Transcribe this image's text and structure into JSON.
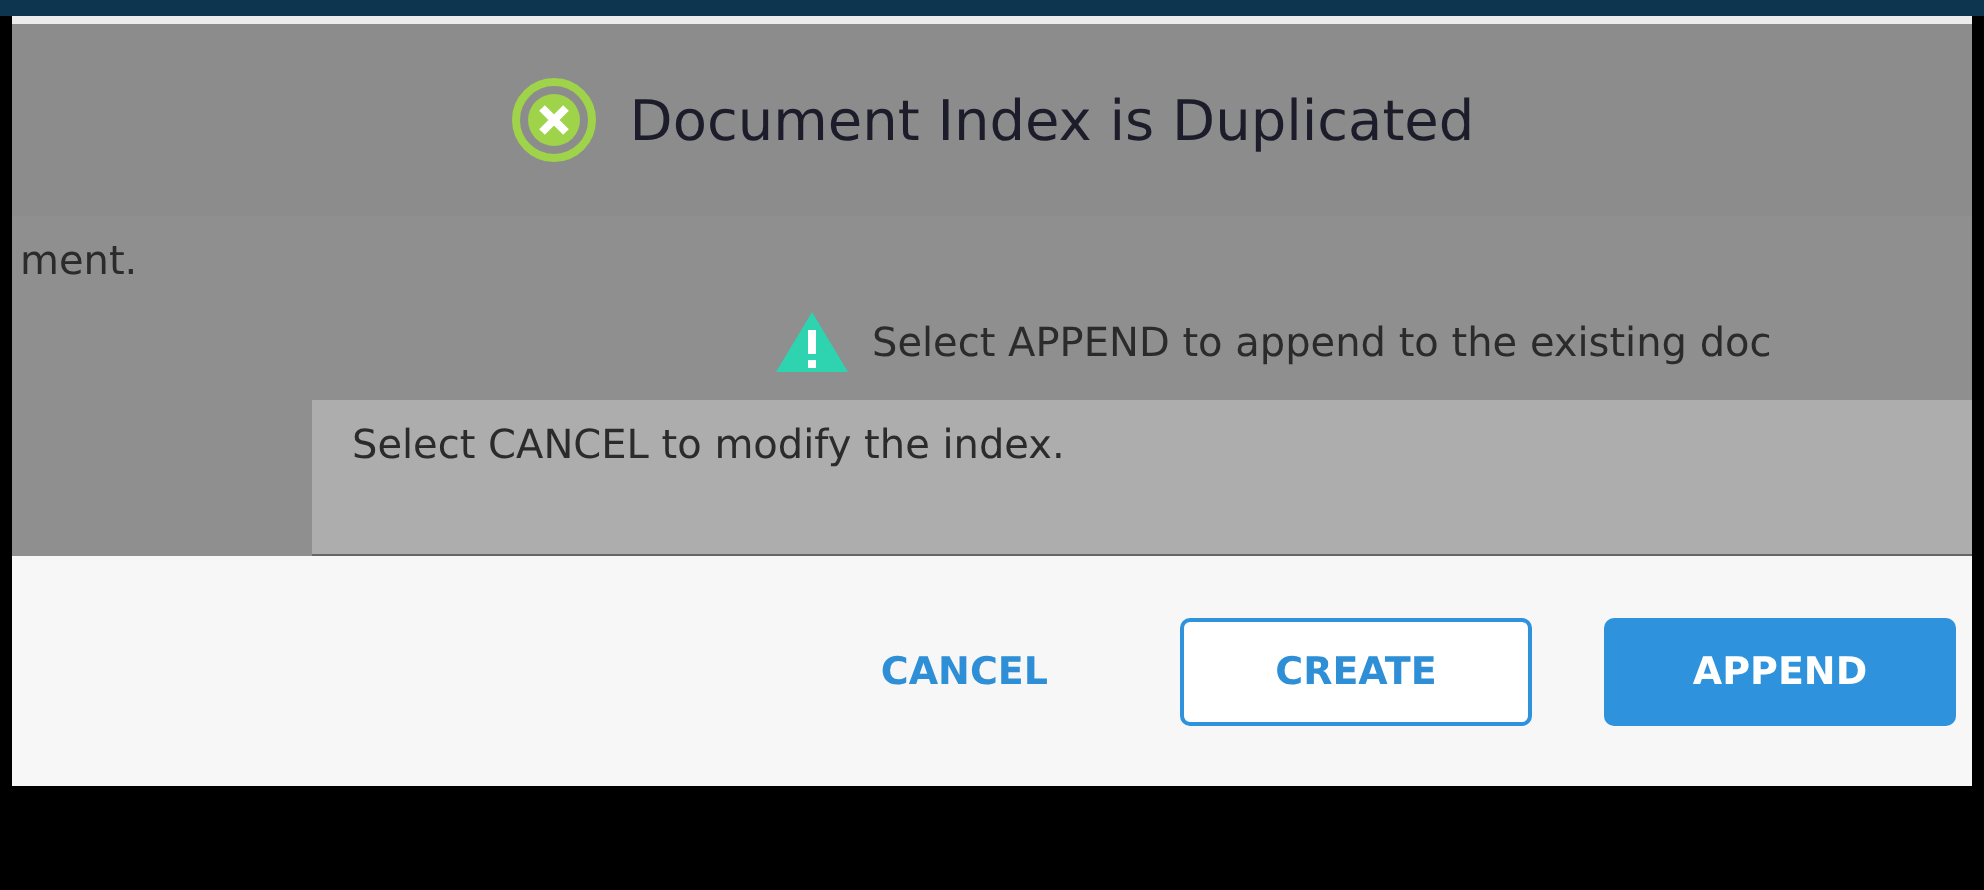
{
  "dialog": {
    "title": "Document Index is Duplicated",
    "messages": [
      {
        "kind": "fragment",
        "text": "ment."
      },
      {
        "kind": "warning",
        "text": "Select APPEND to append to the existing doc"
      },
      {
        "kind": "plain",
        "text": "Select CANCEL to modify the index."
      }
    ],
    "buttons": [
      {
        "label": "CANCEL",
        "kind": "text"
      },
      {
        "label": "CREATE",
        "kind": "outline"
      },
      {
        "label": "APPEND",
        "kind": "primary"
      }
    ]
  }
}
